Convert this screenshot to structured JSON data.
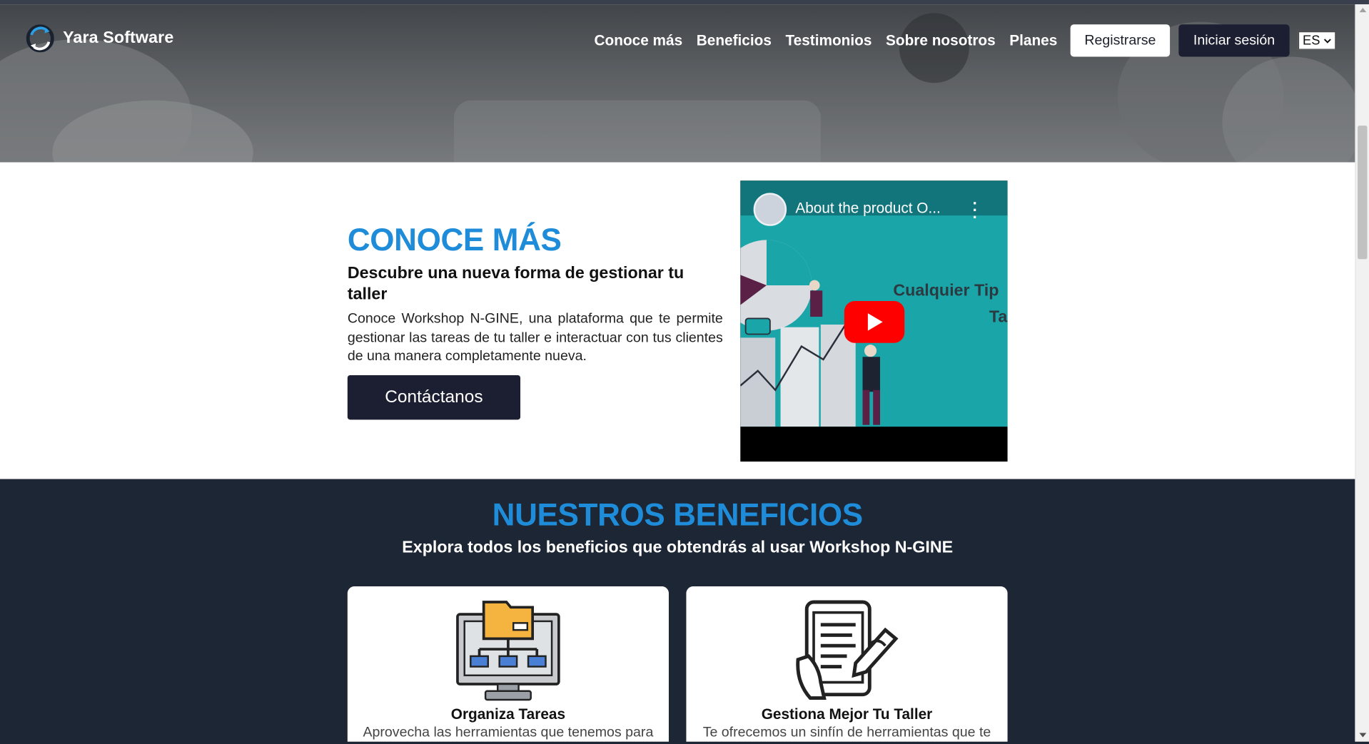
{
  "header": {
    "brand": "Yara Software",
    "nav": [
      "Conoce más",
      "Beneficios",
      "Testimonios",
      "Sobre nosotros",
      "Planes"
    ],
    "register_label": "Registrarse",
    "login_label": "Iniciar sesión",
    "language": "ES"
  },
  "about": {
    "title": "CONOCE MÁS",
    "subtitle": "Descubre una nueva forma de gestionar tu taller",
    "body": "Conoce Workshop N-GINE, una plataforma que te permite gestionar las tareas de tu taller e interactuar con tus clientes de una manera completamente nueva.",
    "cta": "Contáctanos",
    "video": {
      "title": "About the product O...",
      "overlay_line1": "Cualquier Tip",
      "overlay_line2": "Ta"
    }
  },
  "benefits": {
    "title": "NUESTROS BENEFICIOS",
    "subtitle": "Explora todos los beneficios que obtendrás al usar Workshop N-GINE",
    "cards": [
      {
        "title": "Organiza Tareas",
        "text": "Aprovecha las herramientas que tenemos para",
        "icon": "folder-network-icon"
      },
      {
        "title": "Gestiona Mejor Tu Taller",
        "text": "Te ofrecemos un sinfín de herramientas que te",
        "icon": "tablet-edit-icon"
      }
    ]
  },
  "colors": {
    "accent": "#1e8cd8",
    "dark": "#1c1f32",
    "section_bg": "#1d2634",
    "youtube_red": "#ff0000"
  }
}
